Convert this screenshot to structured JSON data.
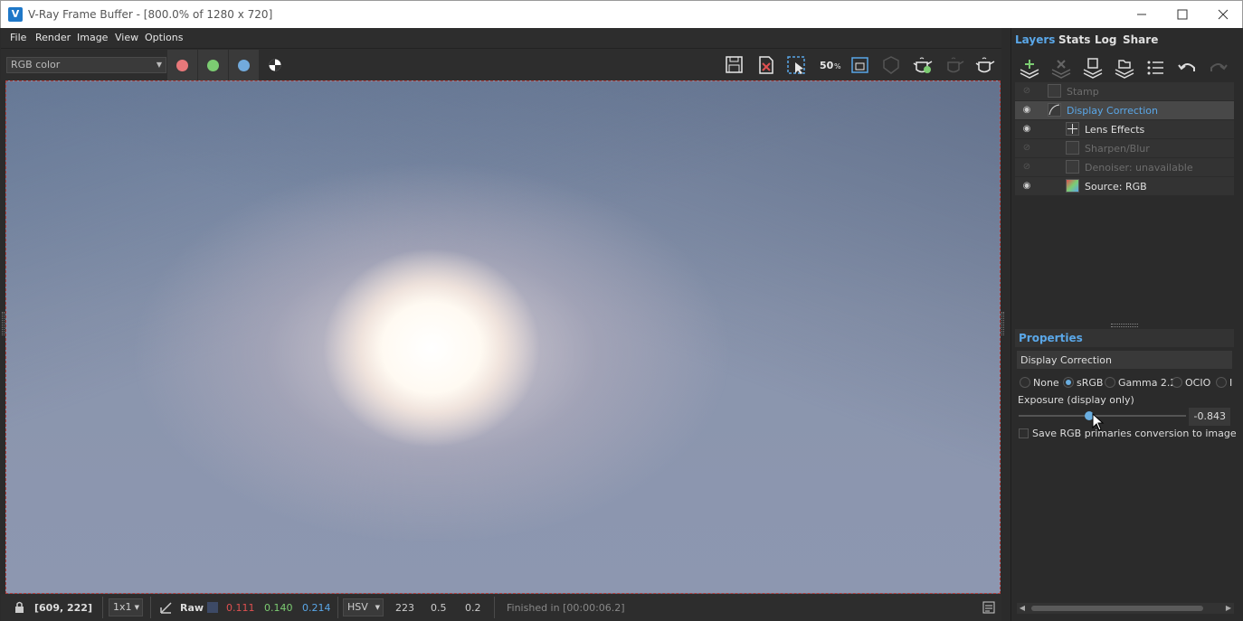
{
  "window": {
    "title": "V-Ray Frame Buffer - [800.0% of 1280 x 720]",
    "app_icon": "vray-logo-icon",
    "controls": [
      "minimize-icon",
      "maximize-icon",
      "close-icon"
    ]
  },
  "menu": {
    "items": [
      "File",
      "Render",
      "Image",
      "View",
      "Options"
    ]
  },
  "toolbar": {
    "channel": "RGB color",
    "channel_buttons": [
      {
        "name": "red-channel",
        "color": "#e8787a"
      },
      {
        "name": "green-channel",
        "color": "#7ccc72"
      },
      {
        "name": "blue-channel",
        "color": "#72aadc"
      },
      {
        "name": "alpha-channel",
        "color": "#ffffff"
      }
    ],
    "zoom_badge": "50",
    "tools": [
      "save-icon",
      "clear-icon",
      "region-render-icon",
      "zoom-50-icon",
      "fit-icon",
      "track-mouse-icon",
      "render-icon",
      "interactive-render-icon",
      "stop-render-icon"
    ]
  },
  "status": {
    "coords": "[609, 222]",
    "zoom": "1x1",
    "mode": "Raw",
    "r": "0.111",
    "g": "0.140",
    "b": "0.214",
    "color_space": "HSV",
    "h": "223",
    "s": "0.5",
    "v": "0.2",
    "message": "Finished in [00:00:06.2]",
    "colors": {
      "r": "#e05050",
      "g": "#7ccc72",
      "b": "#5aa7e8"
    }
  },
  "panel": {
    "tabs": [
      "Layers",
      "Stats",
      "Log",
      "Share"
    ],
    "active_tab": "Layers",
    "layer_tools": [
      "add-layer-icon",
      "delete-layer-icon",
      "save-layers-icon",
      "load-layers-icon",
      "layer-list-icon",
      "undo-icon",
      "redo-icon"
    ],
    "layers": [
      {
        "name": "Stamp",
        "visible": false,
        "enabled": false
      },
      {
        "name": "Display Correction",
        "visible": true,
        "enabled": true,
        "selected": true
      },
      {
        "name": "Lens Effects",
        "visible": true,
        "enabled": true
      },
      {
        "name": "Sharpen/Blur",
        "visible": false,
        "enabled": false
      },
      {
        "name": "Denoiser: unavailable",
        "visible": false,
        "enabled": false
      },
      {
        "name": "Source: RGB",
        "visible": true,
        "enabled": true
      }
    ],
    "properties": {
      "header": "Properties",
      "title": "Display Correction",
      "options": [
        "None",
        "sRGB",
        "Gamma 2.2",
        "OCIO",
        "I"
      ],
      "selected_option": "sRGB",
      "exposure_label": "Exposure (display only)",
      "exposure_value": "-0.843",
      "exposure_level": 0.42,
      "checkbox_label": "Save RGB primaries conversion to image",
      "checkbox_checked": false
    }
  }
}
